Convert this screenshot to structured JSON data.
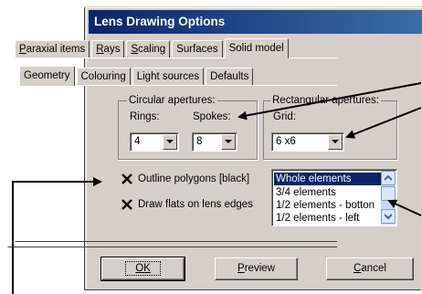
{
  "window": {
    "title": "Lens Drawing Options"
  },
  "outer_tabs": [
    "Paraxial items",
    "Rays",
    "Scaling",
    "Surfaces",
    "Solid model"
  ],
  "outer_active": "Solid model",
  "inner_tabs": [
    "Geometry",
    "Colouring",
    "Light sources",
    "Defaults"
  ],
  "inner_active": "Geometry",
  "circular": {
    "label": "Circular apertures:",
    "rings_label": "Rings:",
    "rings_value": "4",
    "spokes_label": "Spokes:",
    "spokes_value": "8"
  },
  "rectangular": {
    "label": "Rectangular apertures:",
    "grid_label": "Grid:",
    "grid_value": "6 x6"
  },
  "checks": [
    {
      "label": "Outline polygons [black]",
      "checked": true
    },
    {
      "label": "Draw flats on lens edges",
      "checked": true
    }
  ],
  "list": {
    "items": [
      "Whole elements",
      "3/4 elements",
      "1/2 elements - botton",
      "1/2 elements - left"
    ],
    "selected": "Whole elements"
  },
  "buttons": {
    "ok": "OK",
    "preview": "Preview",
    "cancel": "Cancel"
  },
  "colors": {
    "title_bar": "#0a246a",
    "dialog_face": "#d4d0c8",
    "selection": "#0a246a"
  },
  "icons": [
    "dropdown-arrow-icon",
    "checkmark-icon",
    "scroll-up-icon",
    "scroll-down-icon",
    "callout-arrow-icon"
  ]
}
